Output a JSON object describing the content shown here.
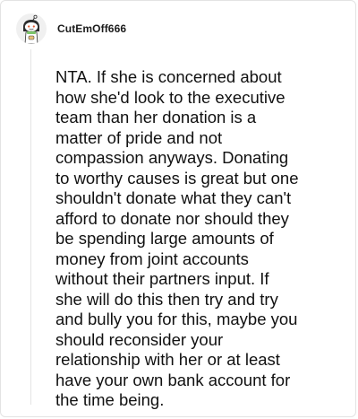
{
  "comment": {
    "username": "CutEmOff666",
    "avatar_icon": "snoo-avatar-icon",
    "body": "NTA. If she is concerned about\nhow she'd look to the executive\nteam than her donation is a\nmatter of pride and not\ncompassion anyways. Donating\nto worthy causes is great but one\nshouldn't donate what they can't\nafford to donate nor should they\nbe spending large amounts of\nmoney from joint accounts\nwithout their partners input. If\nshe will do this then try and try\nand bully you for this, maybe you\nshould reconsider your\nrelationship with her or at least\nhave your own bank account for\nthe time being."
  }
}
